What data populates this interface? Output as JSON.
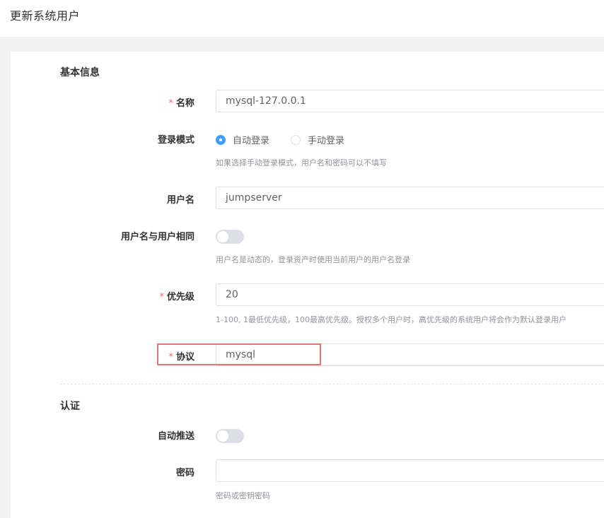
{
  "header": {
    "title": "更新系统用户"
  },
  "sections": {
    "basic": "基本信息",
    "auth": "认证"
  },
  "fields": {
    "name": {
      "label": "名称",
      "required": "*",
      "value": "mysql-127.0.0.1"
    },
    "login_mode": {
      "label": "登录模式",
      "options": [
        "自动登录",
        "手动登录"
      ],
      "selected": "自动登录",
      "help": "如果选择手动登录模式，用户名和密码可以不填写"
    },
    "username": {
      "label": "用户名",
      "value": "jumpserver"
    },
    "username_same_as_user": {
      "label": "用户名与用户相同",
      "on": false,
      "help": "用户名是动态的，登录资产时使用当前用户的用户名登录"
    },
    "priority": {
      "label": "优先级",
      "required": "*",
      "value": "20",
      "help": "1-100, 1最低优先级，100最高优先级。授权多个用户时，高优先级的系统用户将会作为默认登录用户"
    },
    "protocol": {
      "label": "协议",
      "required": "*",
      "value": "mysql"
    },
    "auto_push": {
      "label": "自动推送",
      "on": false
    },
    "password": {
      "label": "密码",
      "value": "",
      "help": "密码或密钥密码"
    }
  },
  "colors": {
    "accent": "#409eff",
    "required": "#f56c6c",
    "highlight": "#e57373",
    "page_bg": "#f2f2f2"
  }
}
